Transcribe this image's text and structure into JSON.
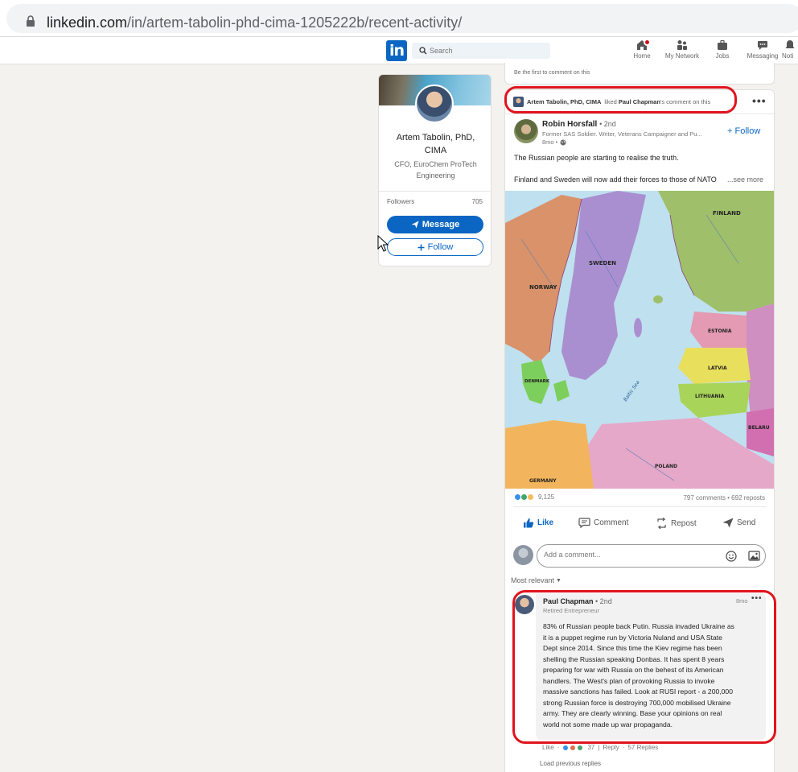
{
  "browser": {
    "url_domain": "linkedin.com",
    "url_path": "/in/artem-tabolin-phd-cima-1205222b/recent-activity/"
  },
  "nav": {
    "logo": "in",
    "search_placeholder": "Search",
    "items": [
      {
        "label": "Home",
        "icon": "home-icon"
      },
      {
        "label": "My Network",
        "icon": "network-icon"
      },
      {
        "label": "Jobs",
        "icon": "jobs-icon"
      },
      {
        "label": "Messaging",
        "icon": "messaging-icon"
      },
      {
        "label": "Noti",
        "icon": "notifications-icon"
      }
    ]
  },
  "profile": {
    "name": "Artem Tabolin, PhD, CIMA",
    "headline": "CFO, EuroChem ProTech Engineering",
    "followers_label": "Followers",
    "followers_count": "705",
    "message_label": "Message",
    "follow_label": "Follow"
  },
  "previous_card": {
    "text": "Be the first to comment on this"
  },
  "post": {
    "activity": {
      "actor": "Artem Tabolin, PhD, CIMA",
      "verb": "liked",
      "target": "Paul Chapman",
      "suffix": "'s comment on this"
    },
    "author": {
      "name": "Robin Horsfall",
      "degree": "• 2nd",
      "headline": "Former SAS Soldier. Writer, Veterans Campaigner and Pu...",
      "time": "8mo •"
    },
    "follow_label": "Follow",
    "text_line1": "The Russian people are starting to realise the truth.",
    "text_line2": "Finland and Sweden will now add their forces to those of NATO",
    "see_more": "...see more",
    "map_labels": {
      "finland": "FINLAND",
      "sweden": "SWEDEN",
      "norway": "NORWAY",
      "estonia": "ESTONIA",
      "latvia": "LATVIA",
      "lithuania": "LITHUANIA",
      "denmark": "DENMARK",
      "poland": "POLAND",
      "belarus": "BELARU",
      "germany": "GERMANY",
      "baltic_sea": "Baltic Sea"
    },
    "reaction_count": "9,125",
    "stats": "797 comments • 692 reposts",
    "actions": {
      "like": "Like",
      "comment": "Comment",
      "repost": "Repost",
      "send": "Send"
    },
    "comment_placeholder": "Add a comment...",
    "sort_label": "Most relevant"
  },
  "comment": {
    "name": "Paul Chapman",
    "degree": "• 2nd",
    "headline": "Retired Entrepreneur",
    "time": "8mo",
    "text": "83% of Russian people back Putin. Russia invaded Ukraine as\nit is a puppet regime run by Victoria Nuland and USA State\nDept since 2014. Since this time the Kiev regime has been\nshelling the Russian speaking Donbas. It has spent 8 years\npreparing for war with Russia on the behest of its American\nhandlers. The West's plan of provoking Russia to invoke\nmassive sanctions has failed. Look at RUSI report - a 200,000\nstrong Russian force is destroying 700,000 mobilised Ukraine\narmy. They are clearly winning. Base your opinions on real\nworld not some made up war propaganda.",
    "like_label": "Like",
    "reaction_count": "37",
    "reply_label": "Reply",
    "replies": "57 Replies",
    "load_previous": "Load previous replies"
  },
  "colors": {
    "linkedin_blue": "#0a66c2",
    "annotation_red": "#e0141e",
    "page_bg": "#f3f2ef"
  }
}
